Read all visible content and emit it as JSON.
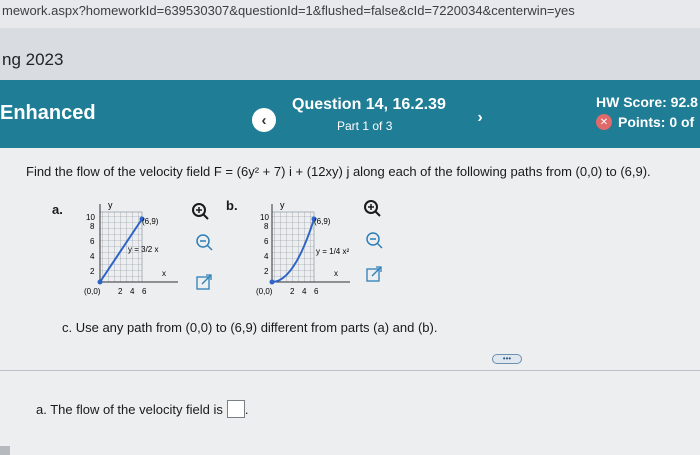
{
  "browser": {
    "url": "mework.aspx?homeworkId=639530307&questionId=1&flushed=false&cId=7220034&centerwin=yes"
  },
  "term": "ng 2023",
  "header": {
    "course": "Enhanced",
    "question_title": "Question 14, 16.2.39",
    "part": "Part 1 of 3",
    "hw_score": "HW Score: 92.8",
    "points": "Points: 0 of",
    "prev_icon": "chevron-left-icon",
    "next_icon": "chevron-right-icon",
    "colors": {
      "band": "#1f7d96",
      "points_icon": "#e06a6a"
    }
  },
  "question": {
    "prompt_lead": "Find the flow of the velocity field F = ",
    "field_expr": "(6y² + 7) i + (12xy) j",
    "prompt_tail": " along each of the following paths from (0,0) to (6,9).",
    "parts": [
      {
        "label": "a.",
        "axis_y": "y",
        "axis_x": "x",
        "y_ticks": [
          "10",
          "8",
          "6",
          "4",
          "2"
        ],
        "x_ticks": [
          "2",
          "4",
          "6"
        ],
        "start": "(0,0)",
        "end": "(6,9)",
        "curve_label": "y = 3/2 x",
        "curve_type": "line"
      },
      {
        "label": "b.",
        "axis_y": "y",
        "axis_x": "x",
        "y_ticks": [
          "10",
          "8",
          "6",
          "4",
          "2"
        ],
        "x_ticks": [
          "2",
          "4",
          "6"
        ],
        "start": "(0,0)",
        "end": "(6,9)",
        "curve_label": "y = 1/4 x²",
        "curve_type": "parabola"
      }
    ],
    "part_c": "c. Use any path from (0,0) to (6,9) different from parts (a) and (b).",
    "more_button": "•••",
    "answer_label": "a. The flow of the velocity field is",
    "answer_tail": "."
  }
}
